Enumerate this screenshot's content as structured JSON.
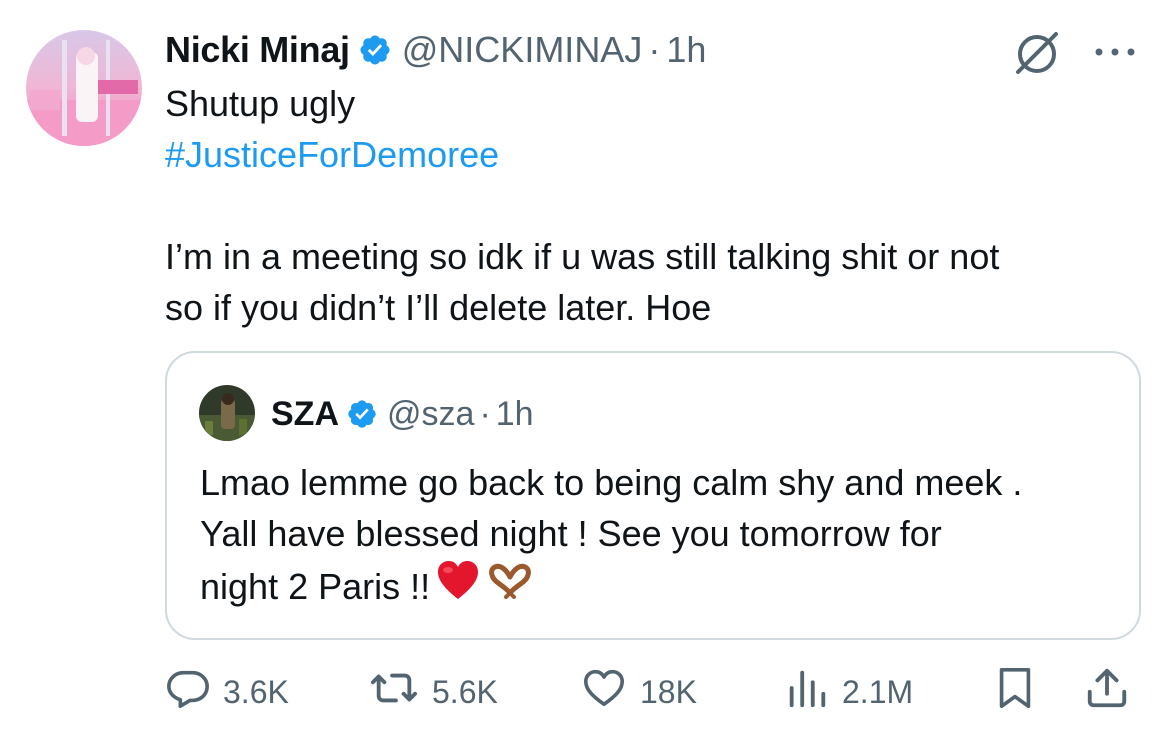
{
  "tweet": {
    "author_name": "Nicki Minaj",
    "author_handle": "@NICKIMINAJ",
    "separator": "·",
    "time": "1h",
    "line1": "Shutup ugly",
    "hashtag": "#JusticeForDemoree",
    "line3": "I’m in a meeting so idk if u was still talking shit or not",
    "line4": "so if you didn’t I’ll delete later. Hoe"
  },
  "quoted_tweet": {
    "author_name": "SZA",
    "author_handle": "@sza",
    "separator": "·",
    "time": "1h",
    "line1": "Lmao lemme go back to being calm shy and meek .",
    "line2": "Yall have blessed night ! See you tomorrow for",
    "line3": "night 2 Paris !!"
  },
  "actions": {
    "replies": "3.6K",
    "reposts": "5.6K",
    "likes": "18K",
    "views": "2.1M"
  },
  "colors": {
    "accent": "#1d9bf0",
    "secondary_text": "#536471",
    "border": "#cfd9de",
    "heart_emoji": "#e3162d"
  },
  "icons": [
    "verified-badge-icon",
    "grok-icon",
    "more-icon",
    "reply-icon",
    "repost-icon",
    "like-icon",
    "views-icon",
    "bookmark-icon",
    "share-icon",
    "red-heart-emoji",
    "heart-hands-emoji"
  ]
}
